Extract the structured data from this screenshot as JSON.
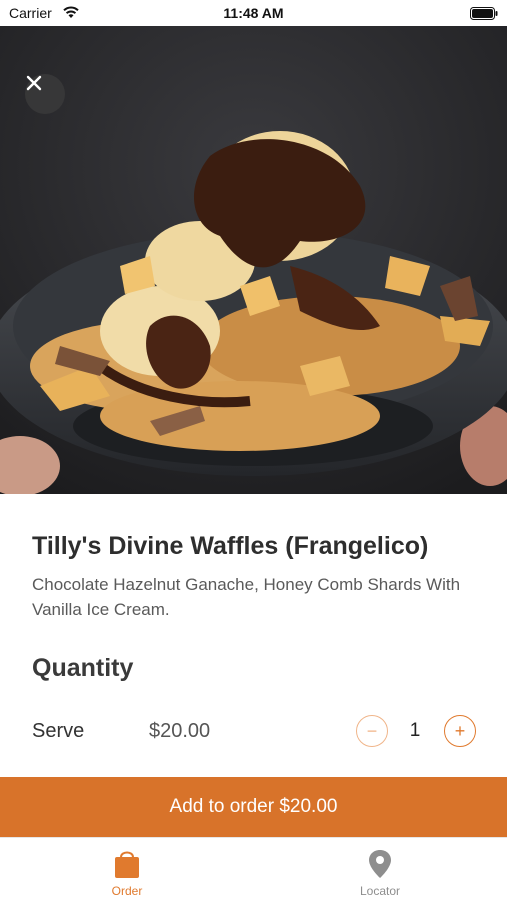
{
  "status_bar": {
    "carrier": "Carrier",
    "time": "11:48 AM"
  },
  "hero": {
    "image_subject": "waffles with chocolate ganache, honeycomb shards and vanilla ice cream in a dark bowl",
    "close_icon": "close-icon"
  },
  "item": {
    "title": "Tilly's Divine Waffles (Frangelico)",
    "description": "Chocolate Hazelnut Ganache, Honey Comb Shards With Vanilla Ice Cream."
  },
  "quantity": {
    "heading": "Quantity",
    "serve_label": "Serve",
    "price": "$20.00",
    "minus_symbol": "−",
    "plus_symbol": "+",
    "count": "1"
  },
  "add_button": {
    "label": "Add to order $20.00"
  },
  "tabs": [
    {
      "label": "Order",
      "icon": "shopping-bag-icon",
      "active": true
    },
    {
      "label": "Locator",
      "icon": "location-pin-icon",
      "active": false
    }
  ],
  "colors": {
    "accent": "#d8732a",
    "accent_light": "#f0b58a",
    "inactive_tab": "#8e8e8e"
  }
}
